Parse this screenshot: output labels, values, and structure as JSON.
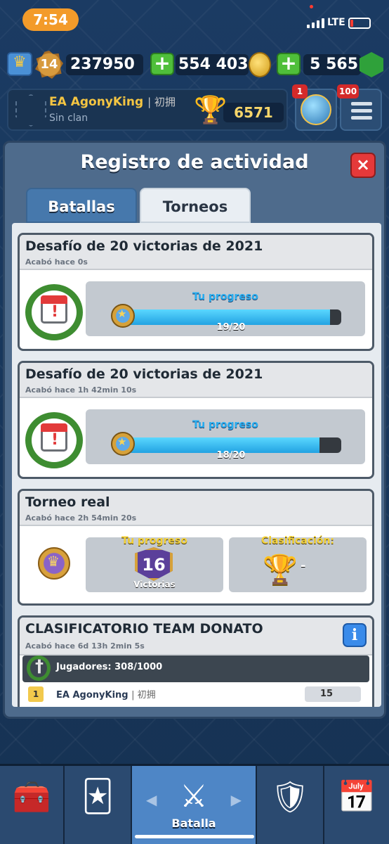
{
  "status_bar": {
    "time": "7:54",
    "network": "LTE"
  },
  "resources": {
    "level": "14",
    "crowns": "237950",
    "gold": "554 403",
    "gems": "5 565",
    "plus_label": "+"
  },
  "profile": {
    "name": "EA AgonyKing",
    "tag": "| 初拥",
    "clan": "Sin clan",
    "trophies": "6571"
  },
  "notifications": {
    "shop_badge": "1",
    "menu_badge": "100"
  },
  "modal": {
    "title": "Registro de actividad",
    "close_label": "×",
    "tabs": [
      {
        "label": "Batallas",
        "active": false
      },
      {
        "label": "Torneos",
        "active": true
      }
    ]
  },
  "entries": [
    {
      "title": "Desafío de 20 victorias de 2021",
      "subtitle": "Acabó hace 0s",
      "progress_label": "Tu progreso",
      "progress_text": "19/20",
      "progress": 0.95
    },
    {
      "title": "Desafío de 20 victorias de 2021",
      "subtitle": "Acabó hace 1h 42min  10s",
      "progress_label": "Tu progreso",
      "progress_text": "18/20",
      "progress": 0.9
    },
    {
      "title": "Torneo real",
      "subtitle": "Acabó hace 2h 54min  20s",
      "progress_label": "Tu progreso",
      "wins": "16",
      "wins_label": "Victorias",
      "rank_label": "Clasificación:",
      "rank_value": "-"
    },
    {
      "title": "CLASIFICATORIO TEAM DONATO",
      "subtitle": "Acabó hace 6d 13h 2min  5s",
      "info_label": "i",
      "players": "Jugadores: 308/1000",
      "rows": [
        {
          "rank": "1",
          "name": "EA AgonyKing",
          "tag": "| 初拥",
          "score": "15"
        }
      ]
    }
  ],
  "bottom_nav": {
    "active_label": "Batalla",
    "left_arrow": "◀",
    "right_arrow": "▶"
  },
  "colors": {
    "accent_blue": "#29aef0",
    "gold": "#f4c542",
    "close_red": "#e5393a"
  }
}
